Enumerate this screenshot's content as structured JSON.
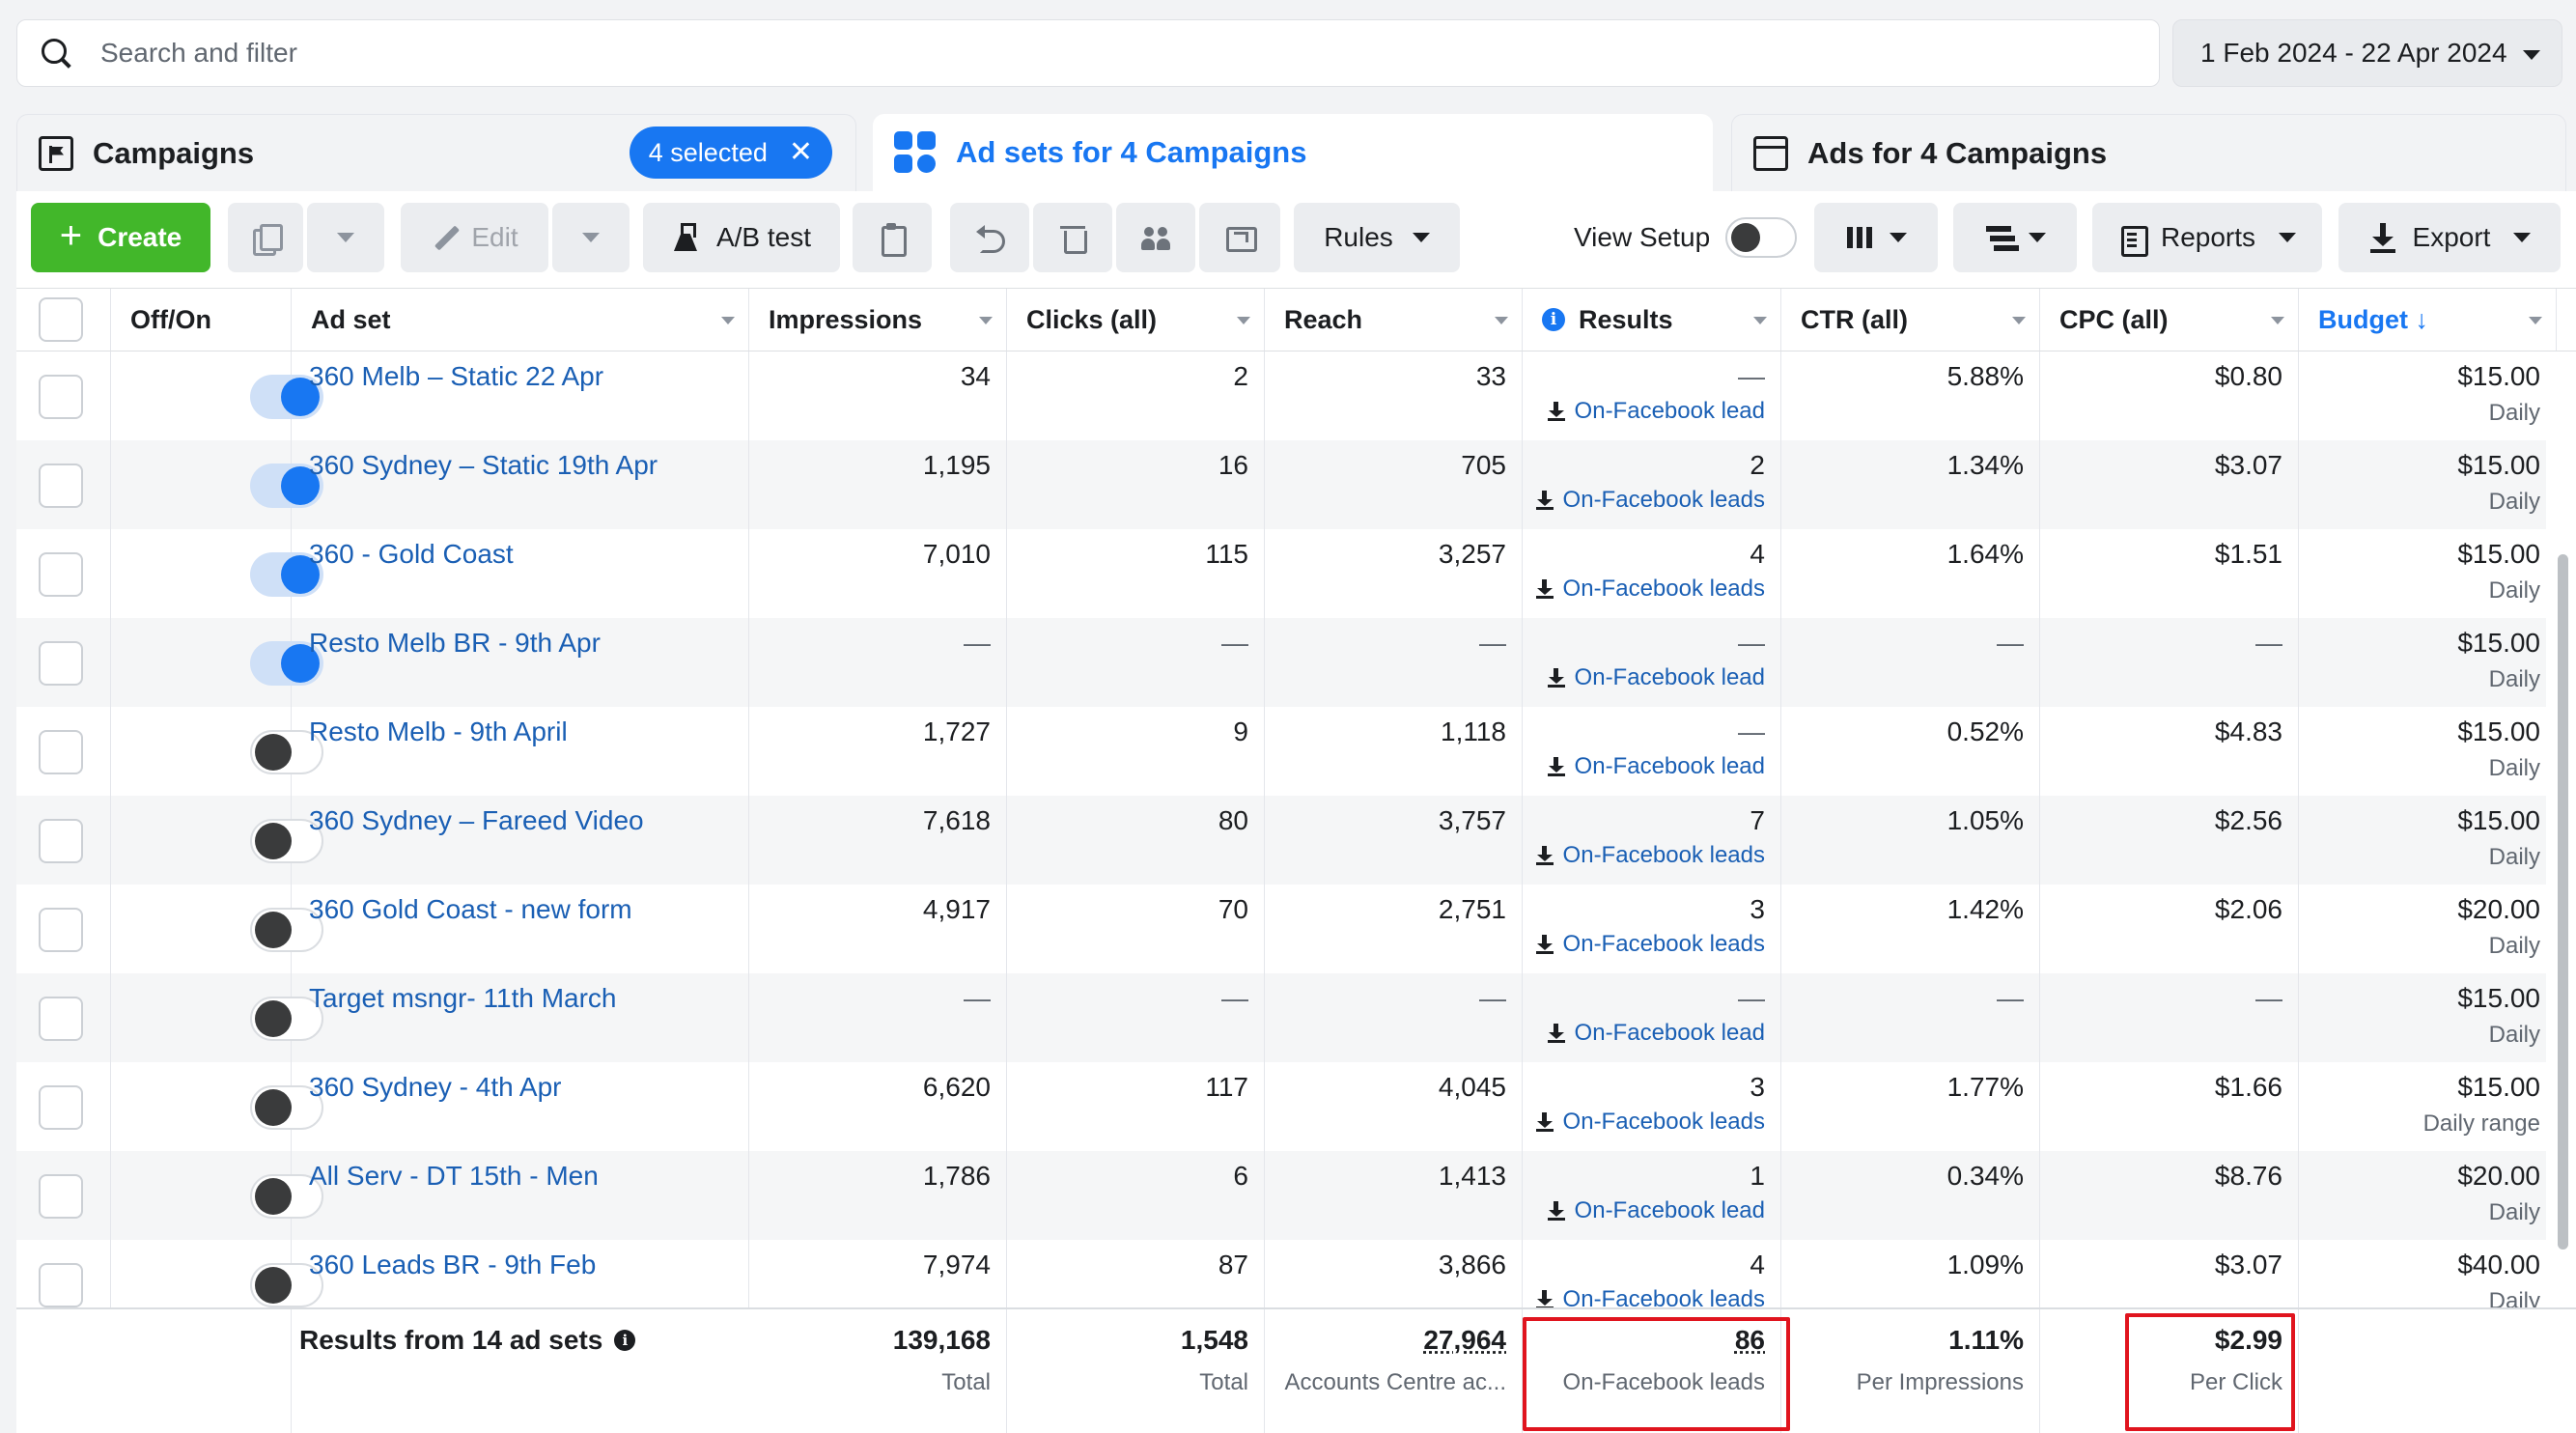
{
  "search": {
    "placeholder": "Search and filter"
  },
  "date_range": "1 Feb 2024 - 22 Apr 2024",
  "tabs": {
    "campaigns": {
      "label": "Campaigns",
      "selected_label": "4 selected"
    },
    "adsets": {
      "label": "Ad sets for 4 Campaigns"
    },
    "ads": {
      "label": "Ads for 4 Campaigns"
    }
  },
  "toolbar": {
    "create": "Create",
    "edit": "Edit",
    "ab_test": "A/B test",
    "rules": "Rules",
    "view_setup": "View Setup",
    "reports": "Reports",
    "export": "Export"
  },
  "columns": {
    "toggle": "Off/On",
    "adset": "Ad set",
    "impressions": "Impressions",
    "clicks": "Clicks (all)",
    "reach": "Reach",
    "results": "Results",
    "ctr": "CTR (all)",
    "cpc": "CPC (all)",
    "budget": "Budget ↓"
  },
  "rows": [
    {
      "name": "360 Melb – Static 22 Apr",
      "on": true,
      "impressions": "34",
      "clicks": "2",
      "reach": "33",
      "results": "—",
      "result_type": "On-Facebook lead",
      "ctr": "5.88%",
      "cpc": "$0.80",
      "budget": "$15.00",
      "budget_type": "Daily"
    },
    {
      "name": "360 Sydney – Static 19th Apr",
      "on": true,
      "impressions": "1,195",
      "clicks": "16",
      "reach": "705",
      "results": "2",
      "result_type": "On-Facebook leads",
      "ctr": "1.34%",
      "cpc": "$3.07",
      "budget": "$15.00",
      "budget_type": "Daily"
    },
    {
      "name": "360 - Gold Coast",
      "on": true,
      "impressions": "7,010",
      "clicks": "115",
      "reach": "3,257",
      "results": "4",
      "result_type": "On-Facebook leads",
      "ctr": "1.64%",
      "cpc": "$1.51",
      "budget": "$15.00",
      "budget_type": "Daily"
    },
    {
      "name": "Resto Melb BR - 9th Apr",
      "on": true,
      "impressions": "—",
      "clicks": "—",
      "reach": "—",
      "results": "—",
      "result_type": "On-Facebook lead",
      "ctr": "—",
      "cpc": "—",
      "budget": "$15.00",
      "budget_type": "Daily"
    },
    {
      "name": "Resto Melb - 9th April",
      "on": false,
      "impressions": "1,727",
      "clicks": "9",
      "reach": "1,118",
      "results": "—",
      "result_type": "On-Facebook lead",
      "ctr": "0.52%",
      "cpc": "$4.83",
      "budget": "$15.00",
      "budget_type": "Daily"
    },
    {
      "name": "360 Sydney – Fareed Video",
      "on": false,
      "impressions": "7,618",
      "clicks": "80",
      "reach": "3,757",
      "results": "7",
      "result_type": "On-Facebook leads",
      "ctr": "1.05%",
      "cpc": "$2.56",
      "budget": "$15.00",
      "budget_type": "Daily"
    },
    {
      "name": "360 Gold Coast - new form",
      "on": false,
      "impressions": "4,917",
      "clicks": "70",
      "reach": "2,751",
      "results": "3",
      "result_type": "On-Facebook leads",
      "ctr": "1.42%",
      "cpc": "$2.06",
      "budget": "$20.00",
      "budget_type": "Daily"
    },
    {
      "name": "Target msngr- 11th March",
      "on": false,
      "impressions": "—",
      "clicks": "—",
      "reach": "—",
      "results": "—",
      "result_type": "On-Facebook lead",
      "ctr": "—",
      "cpc": "—",
      "budget": "$15.00",
      "budget_type": "Daily"
    },
    {
      "name": "360 Sydney - 4th Apr",
      "on": false,
      "impressions": "6,620",
      "clicks": "117",
      "reach": "4,045",
      "results": "3",
      "result_type": "On-Facebook leads",
      "ctr": "1.77%",
      "cpc": "$1.66",
      "budget": "$15.00",
      "budget_type": "Daily range"
    },
    {
      "name": "All Serv - DT 15th - Men",
      "on": false,
      "impressions": "1,786",
      "clicks": "6",
      "reach": "1,413",
      "results": "1",
      "result_type": "On-Facebook lead",
      "ctr": "0.34%",
      "cpc": "$8.76",
      "budget": "$20.00",
      "budget_type": "Daily"
    },
    {
      "name": "360 Leads BR - 9th Feb",
      "on": false,
      "impressions": "7,974",
      "clicks": "87",
      "reach": "3,866",
      "results": "4",
      "result_type": "On-Facebook leads",
      "ctr": "1.09%",
      "cpc": "$3.07",
      "budget": "$40.00",
      "budget_type": "Daily"
    }
  ],
  "summary": {
    "label": "Results from 14 ad sets",
    "impressions": "139,168",
    "impressions_sub": "Total",
    "clicks": "1,548",
    "clicks_sub": "Total",
    "reach": "27,964",
    "reach_sub": "Accounts Centre ac...",
    "results": "86",
    "results_sub": "On-Facebook leads",
    "ctr": "1.11%",
    "ctr_sub": "Per Impressions",
    "cpc": "$2.99",
    "cpc_sub": "Per Click"
  }
}
